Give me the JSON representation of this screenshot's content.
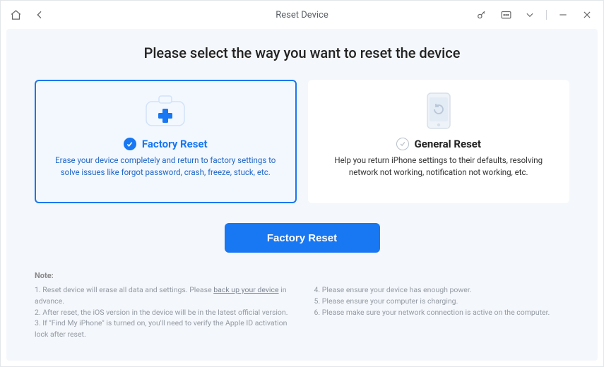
{
  "titlebar": {
    "title": "Reset Device"
  },
  "headline": "Please select the way you want to reset the device",
  "cards": {
    "factory": {
      "title": "Factory Reset",
      "desc": "Erase your device completely and return to factory settings to solve issues like forgot password, crash, freeze, stuck, etc."
    },
    "general": {
      "title": "General Reset",
      "desc": "Help you return iPhone settings to their defaults, resolving network not working, notification not working, etc."
    }
  },
  "action": {
    "label": "Factory Reset"
  },
  "note": {
    "heading": "Note:",
    "left": {
      "l1a": "1. Reset device will erase all data and settings. Please ",
      "l1link": "back up your device",
      "l1b": " in advance.",
      "l2": "2. After reset, the iOS version in the device will be in the latest official version.",
      "l3": "3. If \"Find My iPhone\" is turned on, you'll need to verify the Apple ID activation lock after reset."
    },
    "right": {
      "l4": "4. Please ensure your device has enough power.",
      "l5": "5. Please ensure your computer is charging.",
      "l6": "6. Please make sure your network connection is active on the computer."
    }
  }
}
